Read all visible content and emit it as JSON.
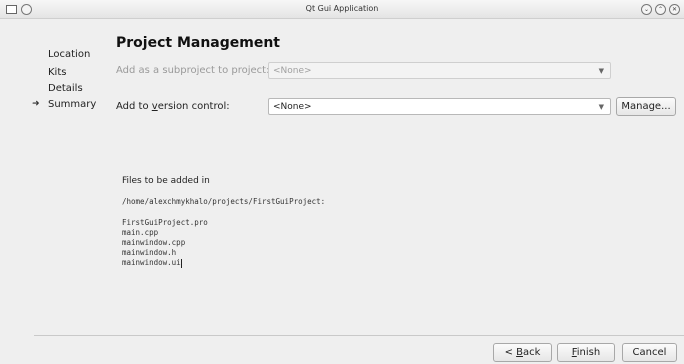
{
  "window": {
    "title": "Qt Gui Application"
  },
  "sidebar": {
    "items": [
      {
        "label": "Location",
        "current": false
      },
      {
        "label": "Kits",
        "current": false
      },
      {
        "label": "Details",
        "current": false
      },
      {
        "label": "Summary",
        "current": true
      }
    ],
    "current_marker": "➜"
  },
  "page": {
    "title": "Project Management"
  },
  "form": {
    "subproject_label": "Add as a subproject to project:",
    "subproject_value": "<None>",
    "vc_label_pre": "Add to ",
    "vc_label_mnemonic": "v",
    "vc_label_post": "ersion control:",
    "vc_value": "<None>",
    "manage_label": "Manage..."
  },
  "files": {
    "heading": "Files to be added in",
    "path": "/home/alexchmykhalo/projects/FirstGuiProject:",
    "list": [
      "FirstGuiProject.pro",
      "main.cpp",
      "mainwindow.cpp",
      "mainwindow.h",
      "mainwindow.ui"
    ]
  },
  "buttons": {
    "back_pre": "< ",
    "back_mnemonic": "B",
    "back_post": "ack",
    "finish_mnemonic": "F",
    "finish_post": "inish",
    "cancel": "Cancel"
  },
  "colors": {
    "background": "#efefef",
    "disabled_text": "#9a9a9a"
  }
}
